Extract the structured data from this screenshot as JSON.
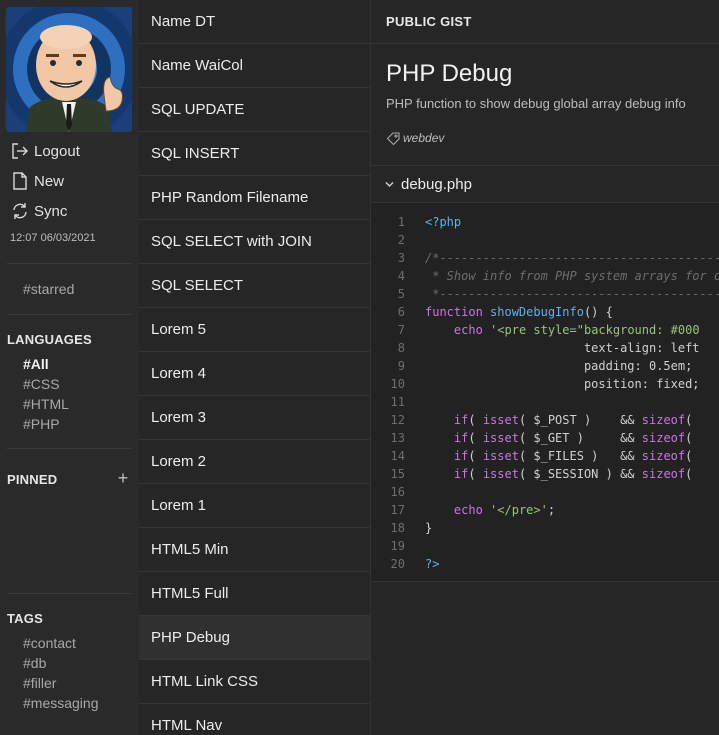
{
  "sidebar": {
    "actions": {
      "logout": "Logout",
      "new": "New",
      "sync": "Sync"
    },
    "last_sync": "12:07 06/03/2021",
    "starred": "#starred",
    "languages": {
      "title": "LANGUAGES",
      "items": [
        "#All",
        "#CSS",
        "#HTML",
        "#PHP"
      ]
    },
    "pinned": {
      "title": "PINNED",
      "add_label": "+"
    },
    "tags": {
      "title": "TAGS",
      "items": [
        "#contact",
        "#db",
        "#filler",
        "#messaging"
      ]
    }
  },
  "gist_list": {
    "items": [
      "Name DT",
      "Name WaiCol",
      "SQL UPDATE",
      "SQL INSERT",
      "PHP Random Filename",
      "SQL SELECT with JOIN",
      "SQL SELECT",
      "Lorem 5",
      "Lorem 4",
      "Lorem 3",
      "Lorem 2",
      "Lorem 1",
      "HTML5 Min",
      "HTML5 Full",
      "PHP Debug",
      "HTML Link CSS",
      "HTML Nav"
    ],
    "selected": "PHP Debug"
  },
  "main": {
    "visibility": "PUBLIC GIST",
    "title": "PHP Debug",
    "description": "PHP function to show debug global array debug info",
    "tag": "webdev",
    "file": {
      "name": "debug.php",
      "lines": [
        "<?php",
        "",
        "/*-------------------------------------------------------------",
        " * Show info from PHP system arrays for debug",
        " *-------------------------------------------------------------",
        "function showDebugInfo() {",
        "    echo '<pre style=\"background: #000",
        "                      text-align: left",
        "                      padding: 0.5em;",
        "                      position: fixed;",
        "",
        "    if( isset( $_POST )    && sizeof(",
        "    if( isset( $_GET )     && sizeof(",
        "    if( isset( $_FILES )   && sizeof(",
        "    if( isset( $_SESSION ) && sizeof(",
        "",
        "    echo '</pre>';",
        "}",
        "",
        "?>"
      ]
    }
  },
  "colors": {
    "accent_function": "#61afef",
    "keyword": "#c678dd",
    "string": "#98c379",
    "comment": "#6c6c6c"
  }
}
